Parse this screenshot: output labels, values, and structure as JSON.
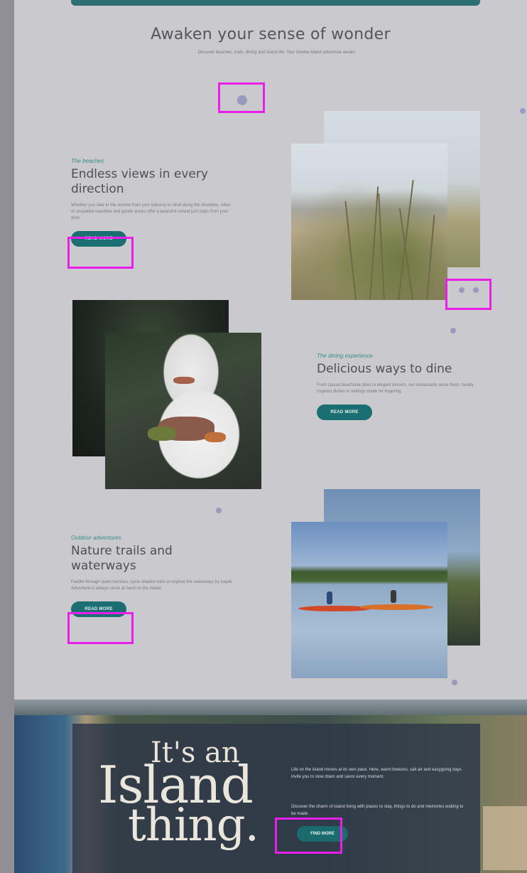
{
  "hero": {
    "title": "Awaken your sense of wonder",
    "subtitle": "Discover beaches, trails, dining and island life. Your Amelia Island adventure awaits."
  },
  "sections": [
    {
      "eyebrow": "The beaches",
      "heading": "Endless views in every direction",
      "body": "Whether you take in the sunrise from your balcony or stroll along the shoreline, miles of unspoiled coastline and gentle dunes offer a peaceful retreat just steps from your door.",
      "button": "READ MORE"
    },
    {
      "eyebrow": "The dining experience",
      "heading": "Delicious ways to dine",
      "body": "From casual beachside bites to elegant dinners, our restaurants serve fresh, locally inspired dishes in settings made for lingering.",
      "button": "READ MORE"
    },
    {
      "eyebrow": "Outdoor adventures",
      "heading": "Nature trails and waterways",
      "body": "Paddle through quiet marshes, cycle shaded trails or explore the waterways by kayak. Adventure is always close at hand on the island.",
      "button": "READ MORE"
    }
  ],
  "island": {
    "line1": "It's an",
    "line2": "Island",
    "line3": "thing.",
    "paragraph1": "Life on the island moves at its own pace. Here, warm breezes, salt air and easygoing days invite you to slow down and savor every moment.",
    "paragraph2": "Discover the charm of island living with places to stay, things to do and memories waiting to be made.",
    "button": "FIND MORE"
  },
  "colors": {
    "accent": "#1b6f72",
    "highlight": "#e91ee9",
    "background": "#c9c9ce"
  }
}
